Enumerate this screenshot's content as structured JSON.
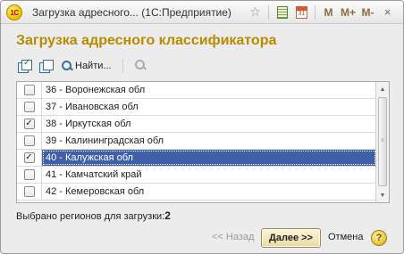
{
  "window": {
    "title": "Загрузка адресного... (1С:Предприятие)",
    "logo_text": "1С",
    "toolbar_buttons": {
      "favorite_icon": "star-icon",
      "calculator_icon": "calculator-icon",
      "calendar_icon": "calendar-icon",
      "calendar_number": "31",
      "m_label": "M",
      "m_plus_label": "M+",
      "m_minus_label": "M-",
      "close_glyph": "×"
    }
  },
  "form": {
    "heading": "Загрузка адресного классификатора",
    "toolbar": {
      "check_all_icon": "check-all-icon",
      "uncheck_all_icon": "uncheck-all-icon",
      "find_label": "Найти...",
      "cancel_search_icon": "cancel-search-icon"
    },
    "regions": [
      {
        "label": "36 - Воронежская обл",
        "checked": false,
        "selected": false
      },
      {
        "label": "37 - Ивановская обл",
        "checked": false,
        "selected": false
      },
      {
        "label": "38 - Иркутская обл",
        "checked": true,
        "selected": false
      },
      {
        "label": "39 - Калининградская обл",
        "checked": false,
        "selected": false
      },
      {
        "label": "40 - Калужская обл",
        "checked": true,
        "selected": true
      },
      {
        "label": "41 - Камчатский край",
        "checked": false,
        "selected": false
      },
      {
        "label": "42 - Кемеровская обл",
        "checked": false,
        "selected": false
      }
    ],
    "selected_count_label": "Выбрано регионов для загрузки:",
    "selected_count": "2",
    "buttons": {
      "back": "<< Назад",
      "next": "Далее >>",
      "cancel": "Отмена",
      "help": "?"
    }
  },
  "colors": {
    "heading": "#b88a00",
    "selection": "#3f5fa8"
  }
}
